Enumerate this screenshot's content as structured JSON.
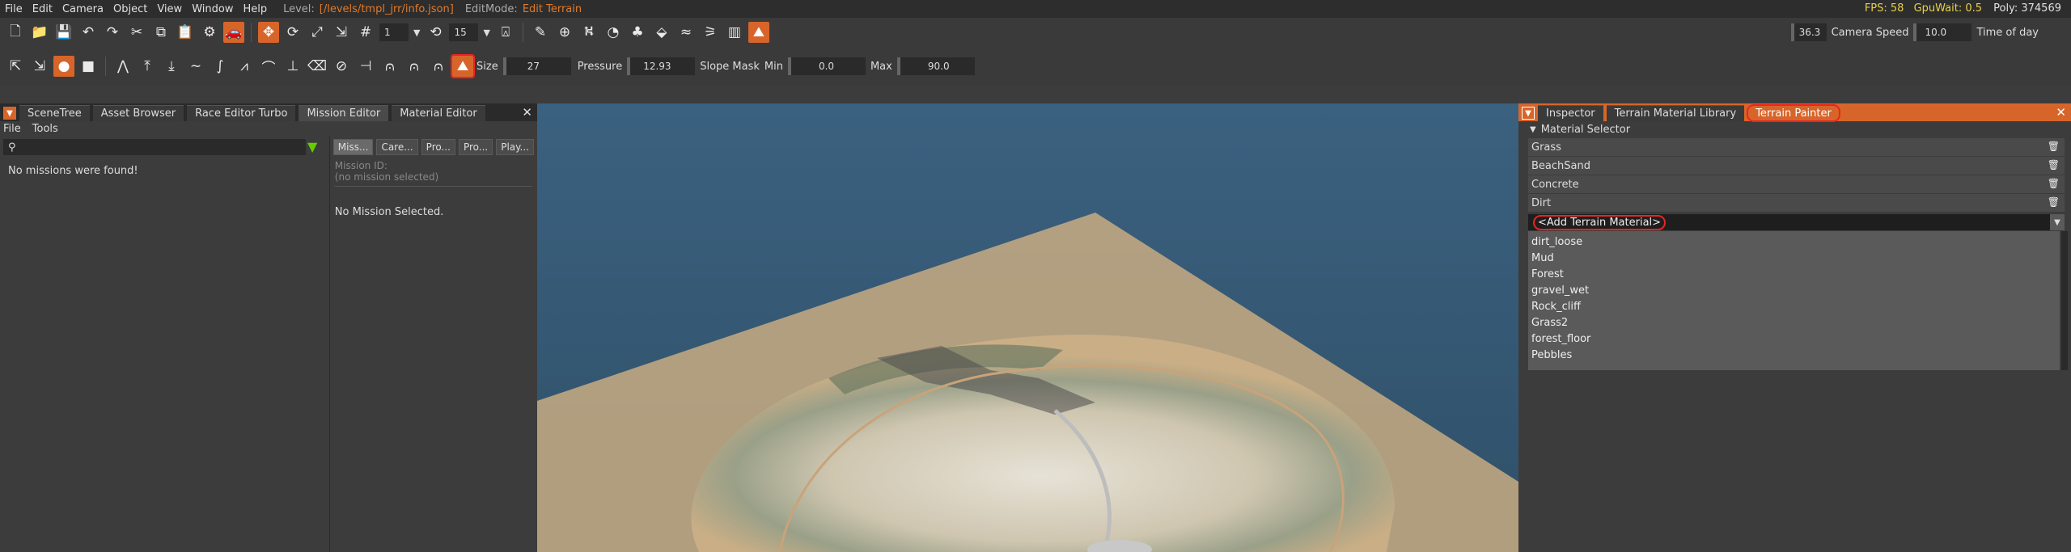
{
  "menubar": {
    "items": [
      "File",
      "Edit",
      "Camera",
      "Object",
      "View",
      "Window",
      "Help"
    ],
    "level_label": "Level:",
    "level_path": "[/levels/tmpl_jrr/info.json]",
    "editmode_label": "EditMode:",
    "editmode_value": "Edit Terrain",
    "fps": "FPS: 58",
    "gpuwait": "GpuWait: 0.5",
    "poly": "Poly: 374569"
  },
  "toolbar1": {
    "step_value": "1",
    "snap_value": "15",
    "camera_value": "36.3",
    "camera_speed_label": "Camera Speed",
    "camera_speed_value": "10.0",
    "time_of_day_label": "Time of day"
  },
  "toolbar2": {
    "size_label": "Size",
    "size_value": "27",
    "pressure_label": "Pressure",
    "pressure_value": "12.93",
    "slope_label": "Slope Mask",
    "min_label": "Min",
    "min_value": "0.0",
    "max_label": "Max",
    "max_value": "90.0"
  },
  "leftpanel": {
    "tabs": [
      "SceneTree",
      "Asset Browser",
      "Race Editor Turbo",
      "Mission Editor",
      "Material Editor"
    ],
    "menu": [
      "File",
      "Tools"
    ],
    "no_missions": "No missions were found!",
    "subtabs": [
      "Miss...",
      "Care...",
      "Pro...",
      "Pro...",
      "Play..."
    ],
    "mission_id_label": "Mission ID:",
    "mission_id_value": "(no mission selected)",
    "no_mission_selected": "No Mission Selected."
  },
  "rightpanel": {
    "tabs": [
      "Inspector",
      "Terrain Material Library",
      "Terrain Painter"
    ],
    "material_selector": "Material Selector",
    "materials": [
      "Grass",
      "BeachSand",
      "Concrete",
      "Dirt"
    ],
    "add_material": "<Add Terrain Material>",
    "dropdown_options": [
      "dirt_loose",
      "Mud",
      "Forest",
      "gravel_wet",
      "Rock_cliff",
      "Grass2",
      "forest_floor",
      "Pebbles"
    ]
  },
  "colors": {
    "accent": "#d7652a",
    "highlight": "#ee2222",
    "water": "#375a75",
    "panel": "#3c3c3c"
  }
}
